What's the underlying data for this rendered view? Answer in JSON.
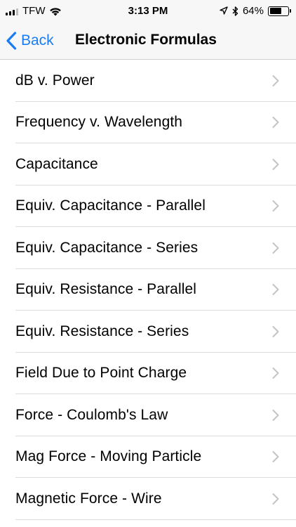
{
  "status_bar": {
    "carrier": "TFW",
    "time": "3:13 PM",
    "battery": "64%",
    "battery_level": 0.64,
    "icons": [
      "signal-icon",
      "wifi-icon",
      "location-icon",
      "bluetooth-icon",
      "battery-icon"
    ]
  },
  "nav": {
    "back_label": "Back",
    "title": "Electronic Formulas",
    "accent_color": "#1a7cf5"
  },
  "list": {
    "items": [
      {
        "label": "dB v. Power"
      },
      {
        "label": "Frequency v. Wavelength"
      },
      {
        "label": "Capacitance"
      },
      {
        "label": "Equiv. Capacitance - Parallel"
      },
      {
        "label": "Equiv. Capacitance - Series"
      },
      {
        "label": "Equiv. Resistance - Parallel"
      },
      {
        "label": "Equiv. Resistance - Series"
      },
      {
        "label": "Field Due to Point Charge"
      },
      {
        "label": "Force - Coulomb's Law"
      },
      {
        "label": "Mag Force - Moving Particle"
      },
      {
        "label": "Magnetic Force - Wire"
      }
    ]
  }
}
